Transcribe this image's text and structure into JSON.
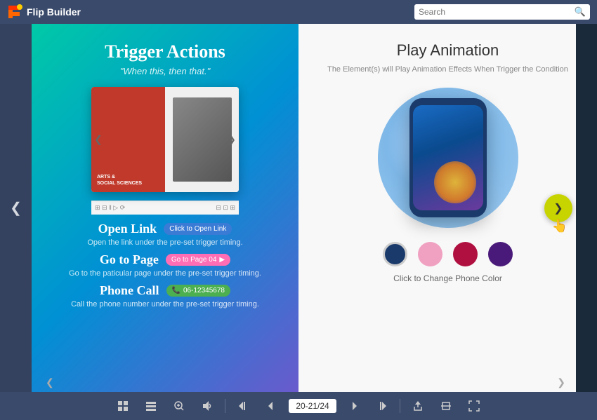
{
  "header": {
    "logo_text": "Flip Builder",
    "search_placeholder": "Search"
  },
  "left_page": {
    "title": "Trigger Actions",
    "subtitle": "\"When this, then that.\"",
    "book_preview": {
      "left_label1": "ARTS &",
      "left_label2": "SOCIAL SCIENCES"
    },
    "actions": [
      {
        "title": "Open Link",
        "btn_label": "Click to Open Link",
        "btn_type": "blue",
        "description": "Open the link under the pre-set trigger timing."
      },
      {
        "title": "Go to Page",
        "btn_label": "Go to Page 04",
        "btn_type": "pink",
        "description": "Go to the paticular page under the pre-set trigger timing."
      },
      {
        "title": "Phone Call",
        "btn_label": "06-12345678",
        "btn_type": "green",
        "description": "Call the phone number under the pre-set trigger timing."
      }
    ]
  },
  "right_page": {
    "title": "Play Animation",
    "description": "The Element(s) will Play Animation Effects When Trigger the Condition",
    "phone_colors": [
      "#1a3a6b",
      "#f0a0c0",
      "#b01040",
      "#4a1a7a"
    ],
    "color_caption": "Click to Change Phone Color"
  },
  "footer": {
    "page_indicator": "20-21/24",
    "icons": [
      "grid",
      "list",
      "zoom",
      "volume",
      "prev-start",
      "prev",
      "page",
      "next",
      "next-end",
      "upload",
      "fullscreen-exit",
      "fullscreen"
    ]
  }
}
